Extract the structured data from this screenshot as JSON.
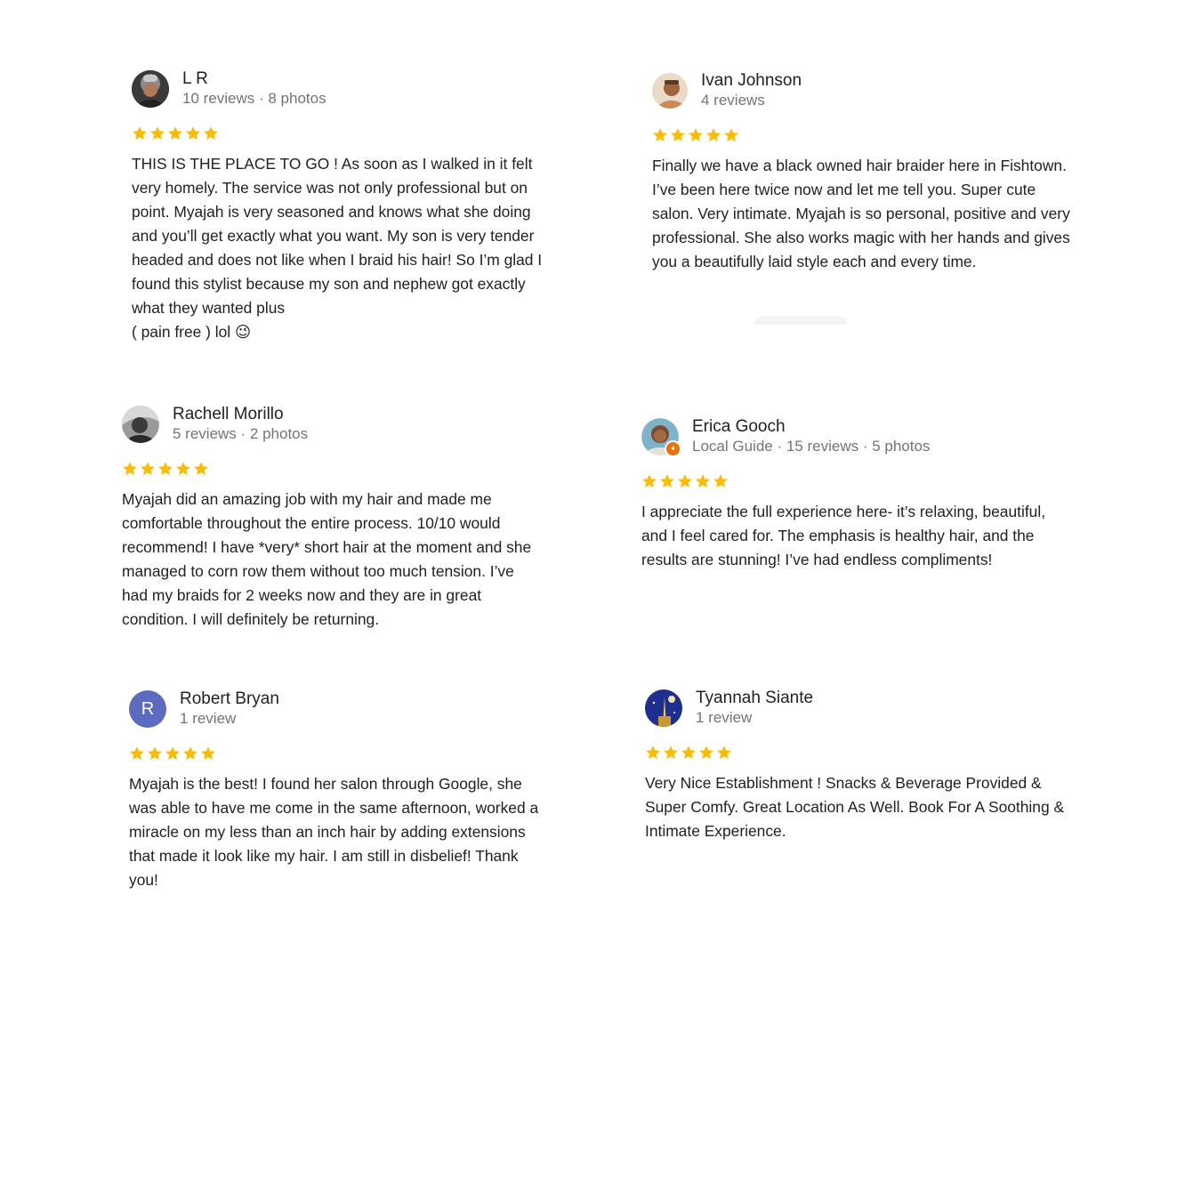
{
  "star_color": "#fbbc04",
  "reviews": [
    {
      "name": "L R",
      "meta": "10 reviews · 8 photos",
      "rating": 5,
      "avatar": "profile-photo",
      "text": "THIS IS THE PLACE TO GO ! As soon as I walked in it felt very homely. The service was not only professional but on point. Myajah is very seasoned and knows what she doing and you’ll get exactly what you want. My son is very tender headed and does not like when I braid his hair! So I’m glad I found this stylist because my son and nephew got exactly what they wanted plus\n( pain free ) lol 😉"
    },
    {
      "name": "Ivan Johnson",
      "meta": "4 reviews",
      "rating": 5,
      "avatar": "profile-photo",
      "text": "Finally we have a black owned hair braider here in Fishtown. I’ve been here twice now and let me tell you. Super cute salon. Very intimate. Myajah is so personal, positive and very professional. She also works magic with her hands and gives you a beautifully laid style each and every time."
    },
    {
      "name": "Rachell Morillo",
      "meta": "5 reviews · 2 photos",
      "rating": 5,
      "avatar": "profile-photo",
      "text": "Myajah did an amazing job with my hair and made me comfortable throughout the entire process. 10/10 would recommend! I have *very* short hair at the moment and she managed to corn row them without too much tension. I’ve had my braids for 2 weeks now and they are in great condition. I will definitely be returning."
    },
    {
      "name": "Erica Gooch",
      "meta": "Local Guide · 15 reviews · 5 photos",
      "rating": 5,
      "avatar": "profile-photo",
      "badge_icon": "local-guide-badge-icon",
      "text": "I appreciate the full experience here- it’s relaxing, beautiful, and I feel cared for. The emphasis is healthy hair, and the results are stunning! I’ve had endless compliments!"
    },
    {
      "name": "Robert Bryan",
      "meta": "1 review",
      "rating": 5,
      "avatar_letter": "R",
      "avatar_color": "#5c6bc0",
      "text": "Myajah is the best! I found her salon through Google, she was able to have me come in the same afternoon, worked a miracle on my less than an inch hair by adding extensions that made it look like my hair. I am still in disbelief! Thank you!"
    },
    {
      "name": "Tyannah Siante",
      "meta": "1 review",
      "rating": 5,
      "avatar": "profile-photo",
      "text": "Very Nice Establishment ! Snacks & Beverage Provided & Super Comfy. Great Location As Well. Book For A Soothing & Intimate Experience."
    }
  ]
}
